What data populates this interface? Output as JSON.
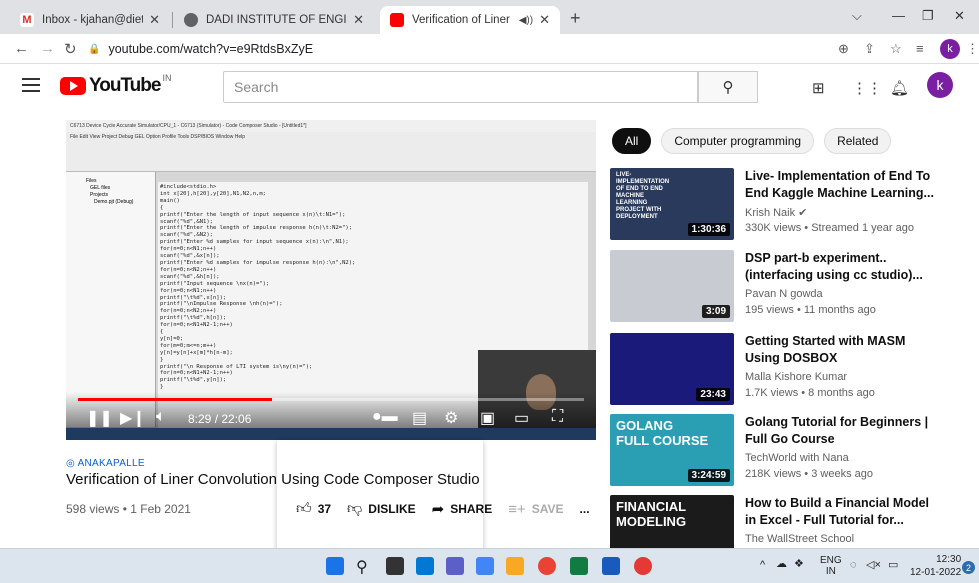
{
  "browser": {
    "tabs": [
      {
        "title": "Inbox - kjahan@diet.edu.in - Dad",
        "icon": "gmail-icon",
        "active": false
      },
      {
        "title": "DADI INSTITUTE OF ENGINEERIN",
        "icon": "globe-icon",
        "active": false
      },
      {
        "title": "Verification of Liner Convolut",
        "icon": "youtube-icon",
        "active": true
      }
    ],
    "new_tab": "+",
    "url": "youtube.com/watch?v=e9RtdsBxZyE",
    "profile_initial": "k"
  },
  "youtube": {
    "logo_text": "YouTube",
    "logo_region": "IN",
    "search_placeholder": "Search",
    "avatar_initial": "k"
  },
  "video": {
    "current_time": "8:29 / 22:06",
    "progress": 0.384,
    "location": "ANAKAPALLE",
    "title": "Verification of Liner Convolution Using Code Composer Studio",
    "meta": "598 views • 1 Feb 2021",
    "likes": "37",
    "dislike_label": "DISLIKE",
    "share_label": "SHARE",
    "save_label": "SAVE",
    "more_label": "...",
    "screen_title": "C6713 Device Cycle Accurate Simulator/CPU_1 - C6713 (Simulator) - Code Composer Studio - [Untitled1*]",
    "screen_menu": "File  Edit  View  Project  Debug  GEL  Option  Profile  Tools  DSP/BIOS  Window  Help",
    "screen_tree": [
      "Files",
      "GEL files",
      "Projects",
      "Demo.pjt (Debug)"
    ],
    "code_lines": [
      "#include<stdio.h>",
      "int x[20],h[20],y[20],N1,N2,n,m;",
      "main()",
      "{",
      "printf(\"Enter the length of input sequence x(n)\\t:N1=\");",
      "scanf(\"%d\",&N1);",
      "printf(\"Enter the length of impulse response h(n)\\t:N2=\");",
      "scanf(\"%d\",&N2);",
      "printf(\"Enter %d samples for input sequence x(n):\\n\",N1);",
      "for(n=0;n<N1;n++)",
      "scanf(\"%d\",&x[n]);",
      "printf(\"Enter %d samples for impulse response h(n):\\n\",N2);",
      "for(n=0;n<N2;n++)",
      "scanf(\"%d\",&h[n]);",
      "printf(\"Input sequence \\nx(n)=\");",
      "for(n=0;n<N1;n++)",
      "printf(\"\\t%d\",x[n]);",
      "printf(\"\\nImpulse Response \\nh(n)=\");",
      "for(n=0;n<N2;n++)",
      "printf(\"\\t%d\",h[n]);",
      "for(n=0;n<N1+N2-1;n++)",
      "{",
      "y[n]=0;",
      "for(m=0;m<=n;m++)",
      "y[n]=y[n]+x[m]*h[n-m];",
      "}",
      "printf(\"\\n Response of LTI system is\\ny(n)=\");",
      "for(n=0;n<N1+N2-1;n++)",
      "printf(\"\\t%d\",y[n]);",
      "}"
    ]
  },
  "sidebar": {
    "chips": [
      "All",
      "Computer programming",
      "Related"
    ],
    "recommendations": [
      {
        "title_line1": "Live- Implementation of End To",
        "title_line2": "End Kaggle Machine Learning...",
        "channel": "Krish Naik",
        "verified": true,
        "stats": "330K views • Streamed 1 year ago",
        "duration": "1:30:36",
        "thumb_text": "LIVE-\nIMPLEMENTATION\nOF END TO END\nMACHINE\nLEARNING\nPROJECT WITH\nDEPLOYMENT",
        "thumb_color": "#2a3a5c"
      },
      {
        "title_line1": "DSP part-b experiment..",
        "title_line2": "(interfacing using cc studio)...",
        "channel": "Pavan N gowda",
        "verified": false,
        "stats": "195 views • 11 months ago",
        "duration": "3:09",
        "thumb_text": "",
        "thumb_color": "#c8ccd2"
      },
      {
        "title_line1": "Getting Started with MASM",
        "title_line2": "Using DOSBOX",
        "channel": "Malla Kishore Kumar",
        "verified": false,
        "stats": "1.7K views • 8 months ago",
        "duration": "23:43",
        "thumb_text": "",
        "thumb_color": "#1a1a7a"
      },
      {
        "title_line1": "Golang Tutorial for Beginners |",
        "title_line2": "Full Go Course",
        "channel": "TechWorld with Nana",
        "verified": false,
        "stats": "218K views • 3 weeks ago",
        "duration": "3:24:59",
        "thumb_text": "GOLANG\nFULL COURSE",
        "thumb_color": "#2a9fb3"
      },
      {
        "title_line1": "How to Build a Financial Model",
        "title_line2": "in Excel - Full Tutorial for...",
        "channel": "The WallStreet School",
        "verified": false,
        "stats": "",
        "duration": "",
        "thumb_text": "FINANCIAL\nMODELING",
        "thumb_color": "#1b1b1b"
      }
    ]
  },
  "taskbar": {
    "lang_top": "ENG",
    "lang_bottom": "IN",
    "time": "12:30",
    "date": "12-01-2022",
    "notifications": "2"
  }
}
